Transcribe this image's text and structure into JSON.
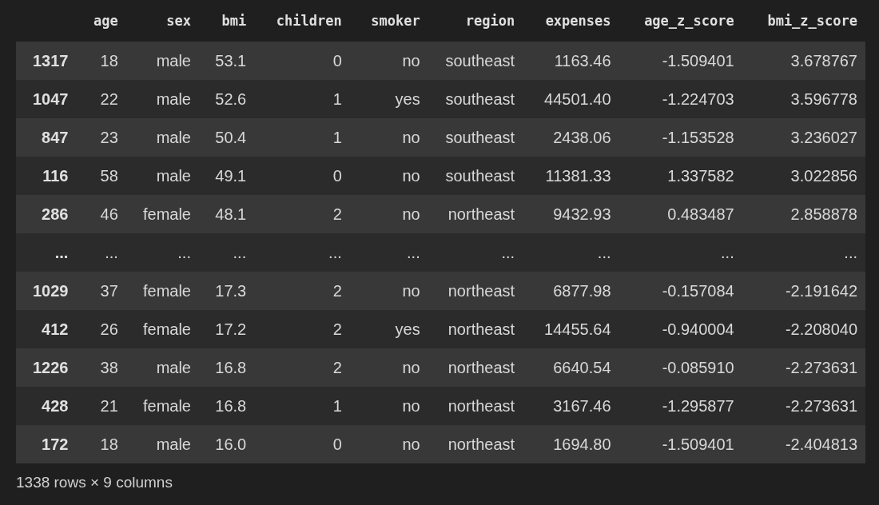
{
  "table": {
    "columns": [
      "age",
      "sex",
      "bmi",
      "children",
      "smoker",
      "region",
      "expenses",
      "age_z_score",
      "bmi_z_score"
    ],
    "rows": [
      {
        "index": "1317",
        "cells": [
          "18",
          "male",
          "53.1",
          "0",
          "no",
          "southeast",
          "1163.46",
          "-1.509401",
          "3.678767"
        ]
      },
      {
        "index": "1047",
        "cells": [
          "22",
          "male",
          "52.6",
          "1",
          "yes",
          "southeast",
          "44501.40",
          "-1.224703",
          "3.596778"
        ]
      },
      {
        "index": "847",
        "cells": [
          "23",
          "male",
          "50.4",
          "1",
          "no",
          "southeast",
          "2438.06",
          "-1.153528",
          "3.236027"
        ]
      },
      {
        "index": "116",
        "cells": [
          "58",
          "male",
          "49.1",
          "0",
          "no",
          "southeast",
          "11381.33",
          "1.337582",
          "3.022856"
        ]
      },
      {
        "index": "286",
        "cells": [
          "46",
          "female",
          "48.1",
          "2",
          "no",
          "northeast",
          "9432.93",
          "0.483487",
          "2.858878"
        ]
      },
      {
        "index": "...",
        "cells": [
          "...",
          "...",
          "...",
          "...",
          "...",
          "...",
          "...",
          "...",
          "..."
        ]
      },
      {
        "index": "1029",
        "cells": [
          "37",
          "female",
          "17.3",
          "2",
          "no",
          "northeast",
          "6877.98",
          "-0.157084",
          "-2.191642"
        ]
      },
      {
        "index": "412",
        "cells": [
          "26",
          "female",
          "17.2",
          "2",
          "yes",
          "northeast",
          "14455.64",
          "-0.940004",
          "-2.208040"
        ]
      },
      {
        "index": "1226",
        "cells": [
          "38",
          "male",
          "16.8",
          "2",
          "no",
          "northeast",
          "6640.54",
          "-0.085910",
          "-2.273631"
        ]
      },
      {
        "index": "428",
        "cells": [
          "21",
          "female",
          "16.8",
          "1",
          "no",
          "northeast",
          "3167.46",
          "-1.295877",
          "-2.273631"
        ]
      },
      {
        "index": "172",
        "cells": [
          "18",
          "male",
          "16.0",
          "0",
          "no",
          "northeast",
          "1694.80",
          "-1.509401",
          "-2.404813"
        ]
      }
    ]
  },
  "footer": "1338 rows × 9 columns"
}
